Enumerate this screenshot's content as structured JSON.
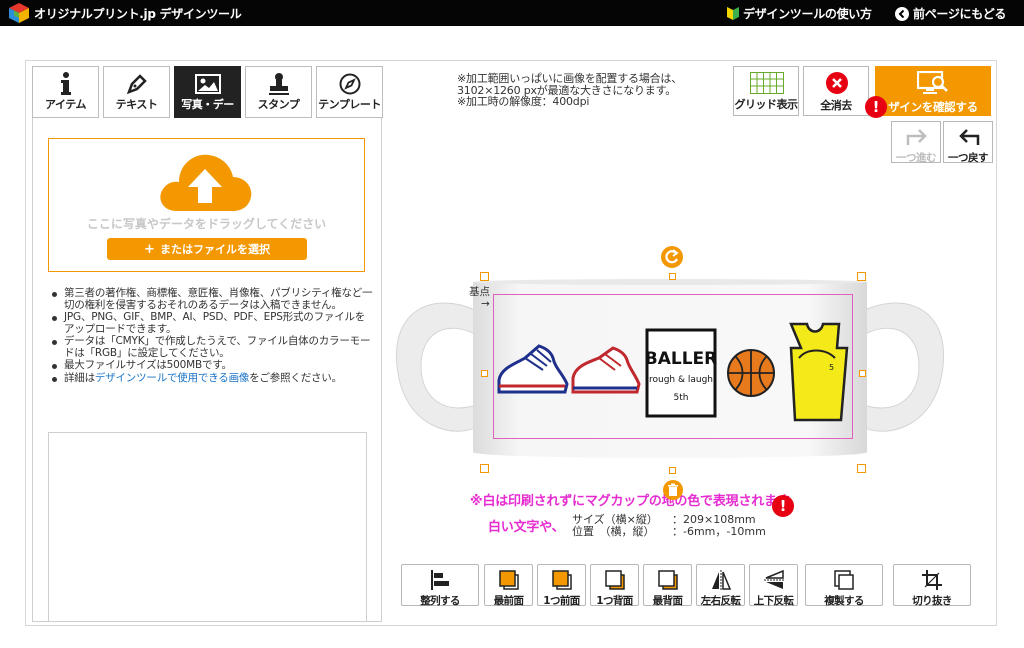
{
  "header": {
    "title": "オリジナルプリント.jp デザインツール",
    "how_to_link": "デザインツールの使い方",
    "back_link": "前ページにもどる"
  },
  "tabs": [
    {
      "label": "アイテム",
      "icon": "info-icon"
    },
    {
      "label": "テキスト",
      "icon": "pen-icon"
    },
    {
      "label": "写真・デー",
      "icon": "image-icon",
      "active": true
    },
    {
      "label": "スタンプ",
      "icon": "stamp-icon"
    },
    {
      "label": "テンプレート",
      "icon": "compass-icon"
    }
  ],
  "upload": {
    "drop_text": "ここに写真やデータをドラッグしてください",
    "select_button": "またはファイルを選択",
    "notes": [
      "第三者の著作権、商標権、意匠権、肖像権、パブリシティ権など一切の権利を侵害するおそれのあるデータは入稿できません。",
      "JPG、PNG、GIF、BMP、AI、PSD、PDF、EPS形式のファイルをアップロードできます。",
      "データは「CMYK」で作成したうえで、ファイル自体のカラーモードは「RGB」に設定してください。",
      "最大ファイルサイズは500MBです。"
    ],
    "last_note": {
      "link": "デザインツールで使用できる画像",
      "rest": "をご参照ください。",
      "prefix": "詳細は"
    }
  },
  "info_text": "※加工範囲いっぱいに画像を配置する場合は、3102×1260 pxが最適な大きさになります。※加工時の解像度：400dpi",
  "toolbar": {
    "grid_label": "グリッド表示",
    "clear_label": "全消去",
    "confirm_label": "ザインを確認する",
    "redo_label": "一つ進む",
    "undo_label": "一つ戻す"
  },
  "canvas": {
    "origin_label": "基点",
    "origin_arrow": "→",
    "design_text": {
      "title": "BALLER",
      "sub": "rough & laugh",
      "num": "5th"
    },
    "warning_line1": "※白は印刷されずにマグカップの地の色で表現されます。",
    "warning_line2": "白い文字や、白い部分は印刷されません。",
    "tooltip": {
      "size_label": "サイズ（横×縦）",
      "size_value": "：209×108mm",
      "pos_label": "位置　（横，縦）",
      "pos_value": "：-6mm，-10mm"
    }
  },
  "bottom_buttons": [
    {
      "label": "整列する",
      "icon": "align-icon"
    },
    {
      "label": "最前面",
      "icon": "bring-front-icon"
    },
    {
      "label": "1つ前面",
      "icon": "bring-forward-icon"
    },
    {
      "label": "1つ背面",
      "icon": "send-backward-icon"
    },
    {
      "label": "最背面",
      "icon": "send-back-icon"
    },
    {
      "label": "左右反転",
      "icon": "flip-horizontal-icon"
    },
    {
      "label": "上下反転",
      "icon": "flip-vertical-icon"
    },
    {
      "label": "複製する",
      "icon": "duplicate-icon"
    },
    {
      "label": "切り抜き",
      "icon": "crop-icon"
    }
  ],
  "colors": {
    "accent": "#f39800",
    "warning": "#e62bd0",
    "badge": "#e60012"
  }
}
